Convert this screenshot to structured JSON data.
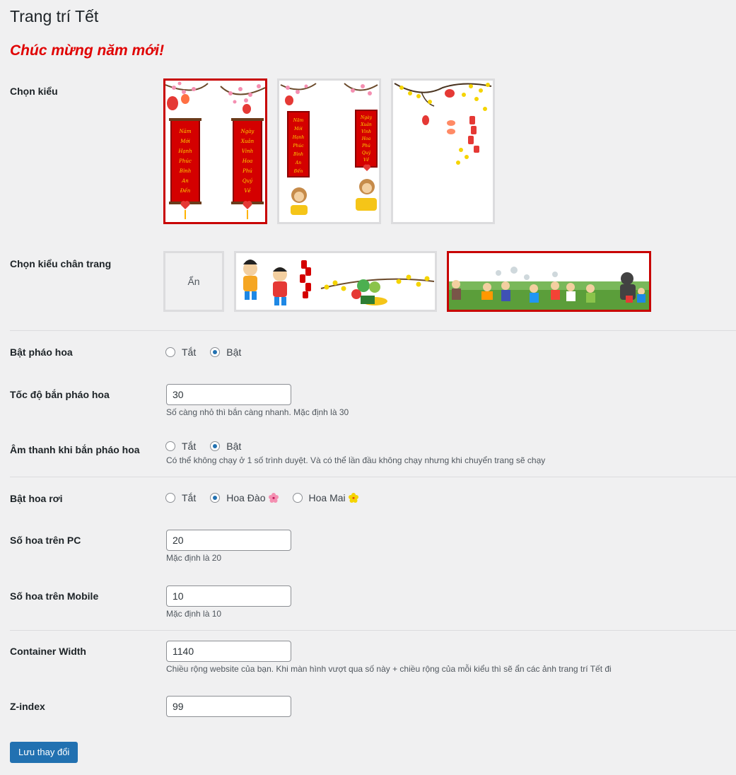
{
  "page": {
    "title": "Trang trí Tết",
    "greeting": "Chúc mừng năm mới!"
  },
  "style_picker": {
    "label": "Chọn kiểu",
    "options": [
      {
        "name": "style-1",
        "selected": true,
        "couplet_left": [
          "Năm",
          "Mới",
          "Hạnh",
          "Phúc",
          "Bình",
          "An",
          "Đến"
        ],
        "couplet_right": [
          "Ngày",
          "Xuân",
          "Vinh",
          "Hoa",
          "Phú",
          "Quý",
          "Về"
        ]
      },
      {
        "name": "style-2",
        "selected": false,
        "couplet_left": [
          "Năm",
          "Mới",
          "Hạnh",
          "Phúc",
          "Bình",
          "An",
          "Đến"
        ],
        "couplet_right": [
          "Ngày",
          "Xuân",
          "Vinh",
          "Hoa",
          "Phú",
          "Quý",
          "Về"
        ]
      },
      {
        "name": "style-3",
        "selected": false
      }
    ]
  },
  "footer_picker": {
    "label": "Chọn kiểu chân trang",
    "hide_label": "Ẩn",
    "selected_index": 2
  },
  "fireworks": {
    "label": "Bật pháo hoa",
    "options": [
      "Tắt",
      "Bật"
    ],
    "selected": "Bật"
  },
  "fireworks_speed": {
    "label": "Tốc độ bắn pháo hoa",
    "value": "30",
    "description": "Số càng nhỏ thì bắn càng nhanh. Mặc định là 30"
  },
  "fireworks_sound": {
    "label": "Âm thanh khi bắn pháo hoa",
    "options": [
      "Tắt",
      "Bật"
    ],
    "selected": "Bật",
    "description": "Có thể không chạy ở 1 số trình duyệt. Và có thể lần đầu không chạy nhưng khi chuyển trang sẽ chạy"
  },
  "falling_flowers": {
    "label": "Bật hoa rơi",
    "options": [
      "Tắt",
      "Hoa Đào",
      "Hoa Mai"
    ],
    "selected": "Hoa Đào",
    "icons": [
      "peach-blossom-icon",
      "apricot-blossom-icon"
    ],
    "colors": {
      "peach": "#f48fb1",
      "apricot": "#f5d400"
    }
  },
  "flowers_pc": {
    "label": "Số hoa trên PC",
    "value": "20",
    "description": "Mặc định là 20"
  },
  "flowers_mobile": {
    "label": "Số hoa trên Mobile",
    "value": "10",
    "description": "Mặc định là 10"
  },
  "container_width": {
    "label": "Container Width",
    "value": "1140",
    "description": "Chiều rộng website của bạn. Khi màn hình vượt qua số này + chiều rộng của mỗi kiểu thì sẽ ẩn các ảnh trang trí Tết đi"
  },
  "z_index": {
    "label": "Z-index",
    "value": "99"
  },
  "save_button": {
    "label": "Lưu thay đổi"
  },
  "colors": {
    "accent": "#2271b1",
    "selected_border": "#c80000",
    "greeting": "#e00000",
    "couplet_red": "#d40000",
    "couplet_text": "#ffd700"
  }
}
